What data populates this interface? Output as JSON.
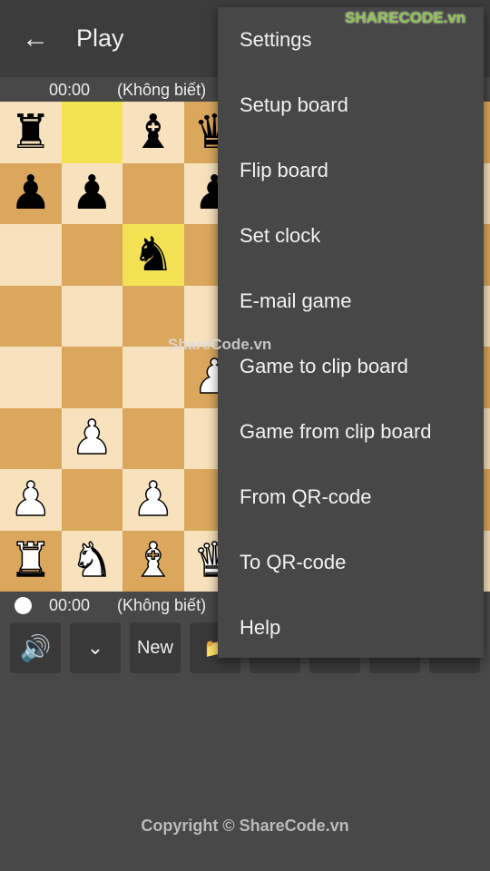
{
  "app_bar": {
    "title": "Play",
    "back_icon": "arrow-left-icon"
  },
  "top_clock": {
    "time": "00:00",
    "player": "(Không biết)"
  },
  "bottom_clock": {
    "time": "00:00",
    "player": "(Không biết)",
    "turn_indicator": "white"
  },
  "board": {
    "rows": [
      "r.bq....",
      "pp.p....",
      "..n.....",
      "........",
      "...P....",
      ".P......",
      "P.P.....",
      "RNBQ...."
    ],
    "highlighted": [
      "b8",
      "c6"
    ],
    "colors": {
      "light": "#f8e1bd",
      "dark": "#dba75d",
      "highlight": "#f2e254"
    }
  },
  "toolbar": [
    {
      "icon": "speaker-icon",
      "label": ""
    },
    {
      "icon": "chevron-down-icon",
      "label": ""
    },
    {
      "icon": "",
      "label": "New"
    },
    {
      "icon": "folder-icon",
      "label": ""
    },
    {
      "icon": "",
      "label": ""
    },
    {
      "icon": "",
      "label": ""
    },
    {
      "icon": "",
      "label": ""
    },
    {
      "icon": "",
      "label": ""
    }
  ],
  "menu": {
    "items": [
      "Settings",
      "Setup board",
      "Flip board",
      "Set clock",
      "E-mail game",
      "Game to clip board",
      "Game from clip board",
      "From QR-code",
      "To QR-code",
      "Help"
    ]
  },
  "watermarks": {
    "logo": "SHARECODE.vn",
    "center": "ShareCode.vn"
  },
  "footer": {
    "copyright": "Copyright © ShareCode.vn"
  }
}
